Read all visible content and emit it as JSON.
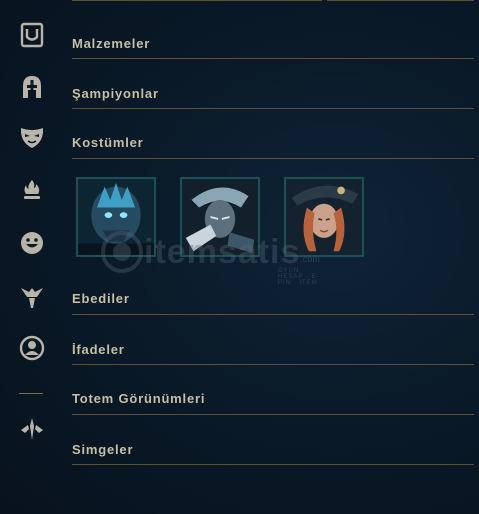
{
  "sidebar": {
    "items": [
      {
        "icon": "items-bag-icon"
      },
      {
        "icon": "champion-helmet-icon"
      },
      {
        "icon": "skin-mask-icon"
      },
      {
        "icon": "flame-icon"
      },
      {
        "icon": "emote-face-icon"
      },
      {
        "icon": "ward-icon"
      },
      {
        "icon": "profile-icon"
      },
      {
        "icon": "arrows-icon"
      }
    ]
  },
  "sections": {
    "items": "Malzemeler",
    "champions": "Şampiyonlar",
    "skins": "Kostümler",
    "eternals": "Ebediler",
    "emotes": "İfadeler",
    "wards": "Totem Görünümleri",
    "icons": "Simgeler"
  },
  "skins": [
    {
      "name": "skin-1",
      "accent": "#3f9fc4"
    },
    {
      "name": "skin-2",
      "accent": "#8aa6b4"
    },
    {
      "name": "skin-3",
      "accent": "#b6623d"
    }
  ],
  "watermark": {
    "text": "itemsatis",
    "tagline": "OYUN · HESAP · E-PIN · ITEM",
    "domain": ".com"
  },
  "colors": {
    "gold": "#c7bfa6",
    "line": "#5e5032",
    "icon": "#b9b4a8",
    "background": "#0a1a29"
  }
}
